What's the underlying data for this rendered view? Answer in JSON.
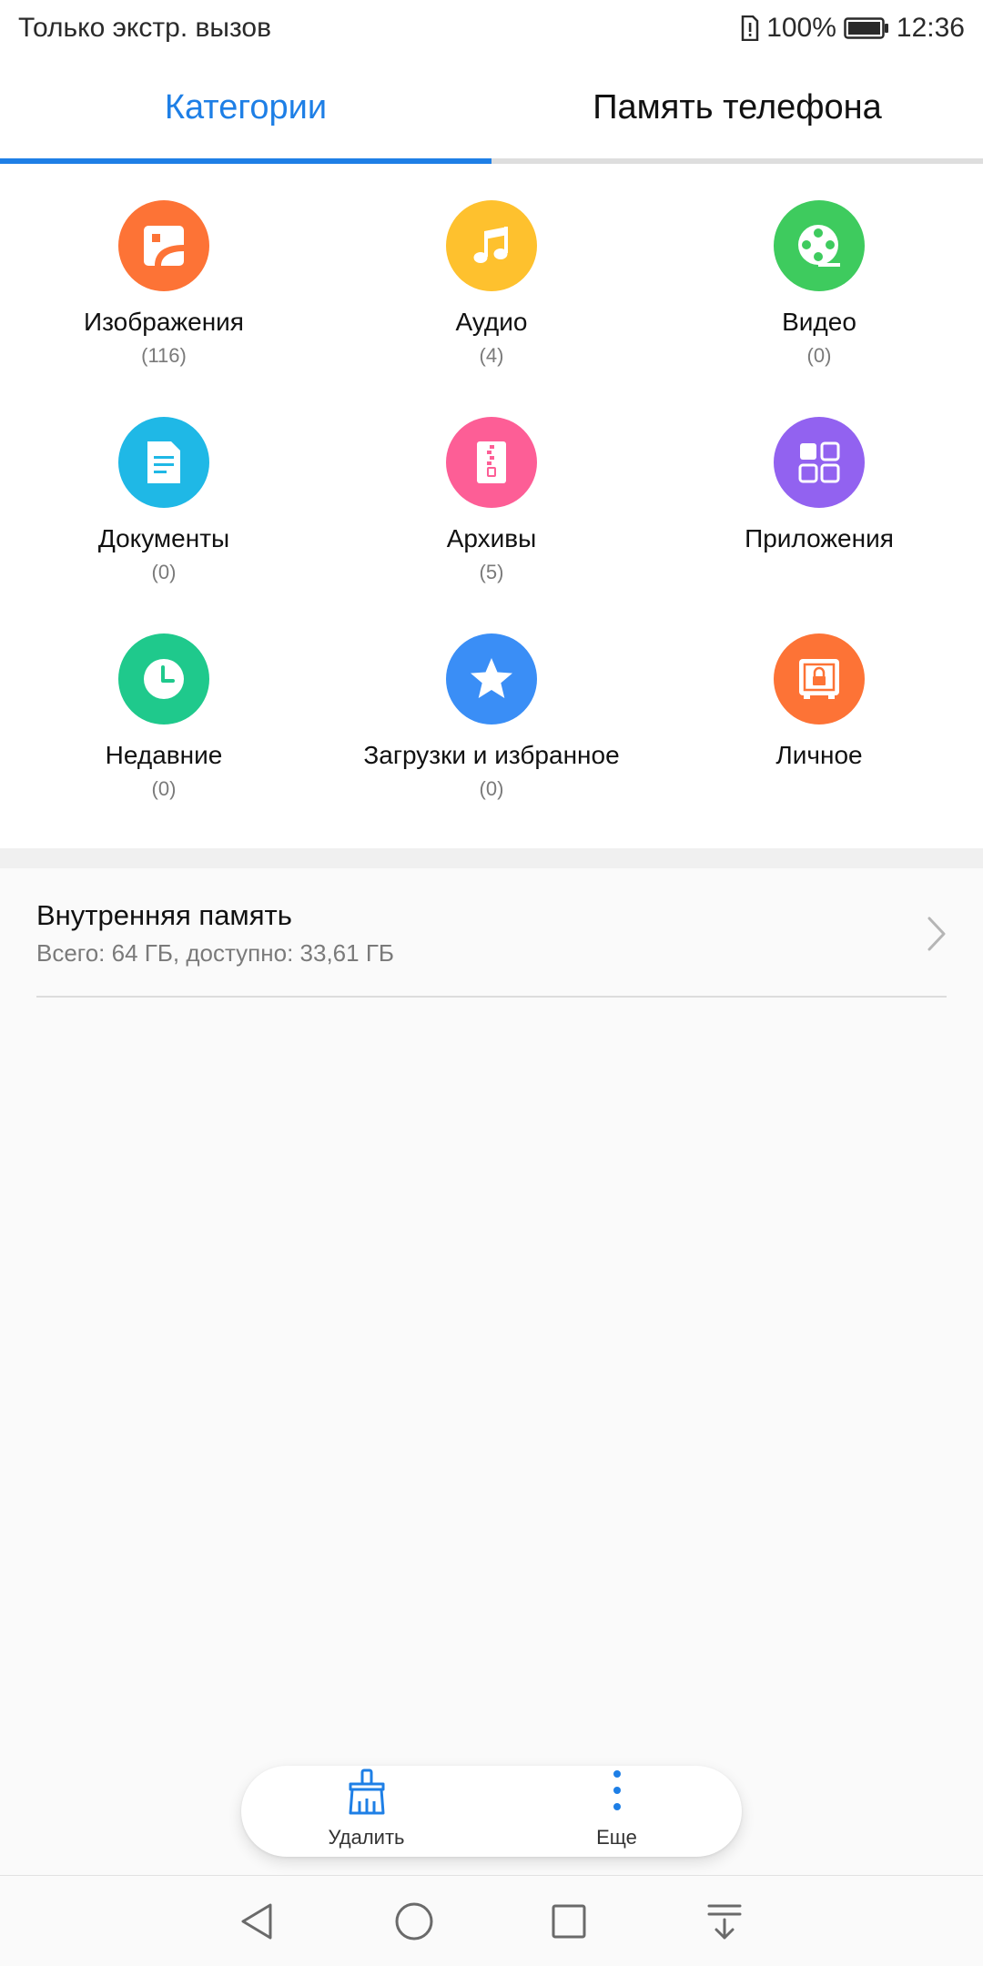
{
  "status_bar": {
    "left_text": "Только экстр. вызов",
    "battery_percent": "100%",
    "time": "12:36"
  },
  "tabs": [
    {
      "label": "Категории",
      "active": true
    },
    {
      "label": "Память телефона",
      "active": false
    }
  ],
  "categories": [
    {
      "label": "Изображения",
      "count": "(116)",
      "icon": "image-icon",
      "color": "#fd7336"
    },
    {
      "label": "Аудио",
      "count": "(4)",
      "icon": "music-note-icon",
      "color": "#fec12e"
    },
    {
      "label": "Видео",
      "count": "(0)",
      "icon": "film-reel-icon",
      "color": "#3ecb5e"
    },
    {
      "label": "Документы",
      "count": "(0)",
      "icon": "document-icon",
      "color": "#1fb8e6"
    },
    {
      "label": "Архивы",
      "count": "(5)",
      "icon": "archive-zip-icon",
      "color": "#fd5e96"
    },
    {
      "label": "Приложения",
      "count": "",
      "icon": "apps-grid-icon",
      "color": "#9262f0"
    },
    {
      "label": "Недавние",
      "count": "(0)",
      "icon": "clock-icon",
      "color": "#1fc98c"
    },
    {
      "label": "Загрузки и избранное",
      "count": "(0)",
      "icon": "star-icon",
      "color": "#3a8ef6"
    },
    {
      "label": "Личное",
      "count": "",
      "icon": "safe-lock-icon",
      "color": "#fd7336"
    }
  ],
  "storage": {
    "title": "Внутренняя память",
    "subtitle": "Всего: 64 ГБ, доступно: 33,61 ГБ"
  },
  "actions": [
    {
      "label": "Удалить",
      "icon": "broom-icon"
    },
    {
      "label": "Еще",
      "icon": "more-vertical-icon"
    }
  ],
  "colors": {
    "accent": "#1e7fe6"
  }
}
